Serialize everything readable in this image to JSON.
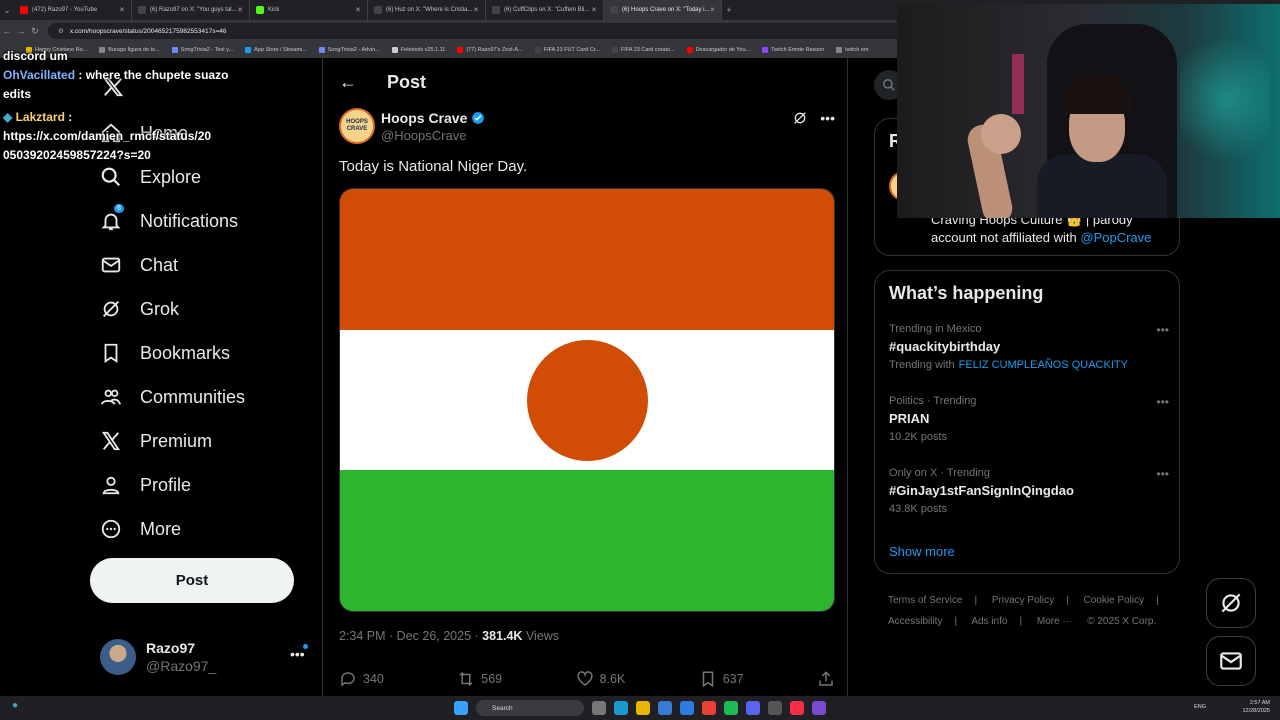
{
  "browser": {
    "tabs": [
      {
        "label": "(472) Razo97 - YouTube",
        "color": "#ff0000",
        "active": false
      },
      {
        "label": "(6) Razo97 on X: \"You guys tal...",
        "color": "#000000",
        "active": false
      },
      {
        "label": "Kick",
        "color": "#53fc18",
        "active": false
      },
      {
        "label": "(6) Huz on X: \"Where is Cristia...",
        "color": "#000000",
        "active": false
      },
      {
        "label": "(6) CuffClips on X: \"Cuffem Bli...",
        "color": "#000000",
        "active": false
      },
      {
        "label": "(6) Hoops Crave on X: \"Today i...",
        "color": "#000000",
        "active": true
      }
    ],
    "new_tab": "+",
    "url": "x.com/hoopscrave/status/2004652175982553417s=46",
    "bookmarks": [
      {
        "label": "Happy Cristiano Ro...",
        "color": "#e8b000"
      },
      {
        "label": "Burago figura de to...",
        "color": "#888888"
      },
      {
        "label": "SongTrivia2 - Test y...",
        "color": "#6a8cff"
      },
      {
        "label": "App Store / Streami...",
        "color": "#1d9bf0"
      },
      {
        "label": "SongTrivia2 - Advin...",
        "color": "#6a8cff"
      },
      {
        "label": "Feletools v25.1.11",
        "color": "#cccccc"
      },
      {
        "label": "(77) Razo97's Zest-A...",
        "color": "#ff0000"
      },
      {
        "label": "FIFA 23 FUT Card Cr...",
        "color": "#444444"
      },
      {
        "label": "FIFA 23 Card creato...",
        "color": "#444444"
      },
      {
        "label": "Descargador de You...",
        "color": "#ff0000"
      },
      {
        "label": "Twitch Emote Resizer",
        "color": "#9147ff"
      },
      {
        "label": "twitch em",
        "color": "#888888"
      }
    ]
  },
  "chat": {
    "top_fragment": "discord um",
    "msg1_user": "OhVacillated",
    "msg1_text": ": where the chupete suazo edits",
    "msg2_user": "Lakztard",
    "msg2_text": ":",
    "msg2_link": "https://x.com/damien_rmcf/status/2005039202459857224?s=20"
  },
  "nav": {
    "items": [
      {
        "label": "Home",
        "icon": "home-icon"
      },
      {
        "label": "Explore",
        "icon": "search-icon"
      },
      {
        "label": "Notifications",
        "icon": "bell-icon",
        "badge": "6"
      },
      {
        "label": "Chat",
        "icon": "mail-icon"
      },
      {
        "label": "Grok",
        "icon": "grok-icon"
      },
      {
        "label": "Bookmarks",
        "icon": "bookmark-icon"
      },
      {
        "label": "Communities",
        "icon": "people-icon"
      },
      {
        "label": "Premium",
        "icon": "x-logo-icon"
      },
      {
        "label": "Profile",
        "icon": "person-icon"
      },
      {
        "label": "More",
        "icon": "more-circle-icon"
      }
    ],
    "post_button": "Post",
    "account_name": "Razo97",
    "account_handle": "@Razo97_",
    "account_more": "•••"
  },
  "post": {
    "header_title": "Post",
    "author_name": "Hoops Crave",
    "author_handle": "@HoopsCrave",
    "avatar_text": "HOOPS CRAVE",
    "text": "Today is National Niger Day.",
    "image_colors": {
      "top": "#d14d05",
      "middle": "#ffffff",
      "bottom": "#2eb52e",
      "circle": "#d14d05"
    },
    "time": "2:34 PM · Dec 26, 2025 ·",
    "views_count": "381.4K",
    "views_label": "Views",
    "replies": "340",
    "reposts": "569",
    "likes": "8.6K",
    "bookmarks": "637"
  },
  "sidebar_right": {
    "relevant_heading": "R",
    "bio": "Craving Hoops Culture 👑 | parody account not affiliated with",
    "bio_link": "@PopCrave",
    "happening_title": "What’s happening",
    "trends": [
      {
        "context": "Trending in Mexico",
        "title": "#quackitybirthday",
        "sub": "Trending with",
        "sub_link": "FELIZ CUMPLEAÑOS QUACKITY"
      },
      {
        "context": "Politics · Trending",
        "title": "PRIAN",
        "sub": "10.2K posts",
        "sub_link": ""
      },
      {
        "context": "Only on X · Trending",
        "title": "#GinJay1stFanSignInQingdao",
        "sub": "43.8K posts",
        "sub_link": ""
      }
    ],
    "show_more": "Show more",
    "footer": [
      "Terms of Service",
      "|",
      "Privacy Policy",
      "|",
      "Cookie Policy",
      "|",
      "Accessibility",
      "|",
      "Ads info",
      "|",
      "More ···",
      "© 2025 X Corp."
    ]
  },
  "taskbar": {
    "search": "Search",
    "lang": "ENG",
    "time": "2:57 AM",
    "date": "12/28/2025"
  }
}
